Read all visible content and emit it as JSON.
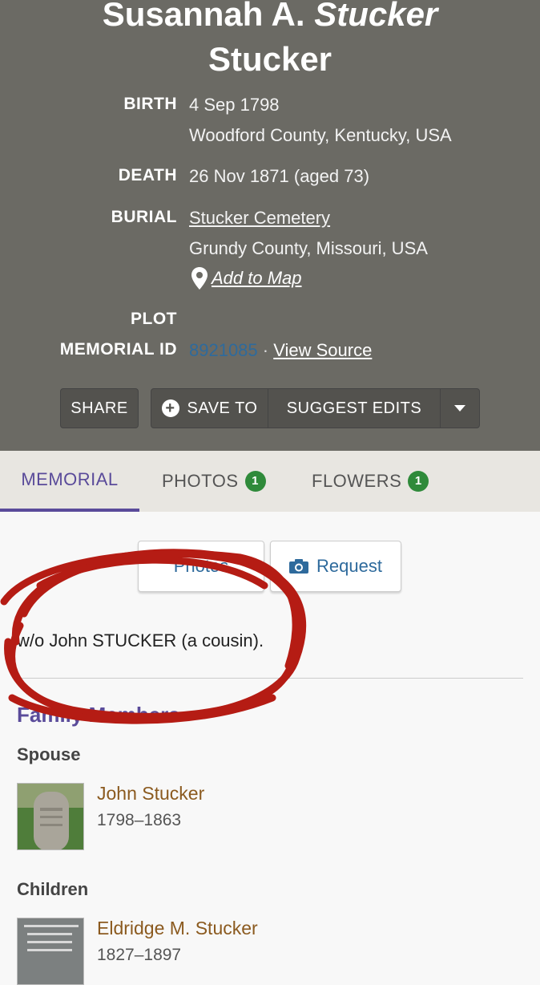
{
  "header": {
    "name_first": "Susannah A.",
    "name_maiden": "Stucker",
    "name_last": "Stucker",
    "birth_label": "BIRTH",
    "birth_date": "4 Sep 1798",
    "birth_place": "Woodford County, Kentucky, USA",
    "death_label": "DEATH",
    "death_date": "26 Nov 1871 (aged 73)",
    "burial_label": "BURIAL",
    "burial_cemetery": "Stucker Cemetery",
    "burial_place": "Grundy County, Missouri, USA",
    "add_to_map": "Add to Map",
    "plot_label": "PLOT",
    "memorial_id_label": "MEMORIAL ID",
    "memorial_id": "8921085",
    "separator": "·",
    "view_source": "View Source"
  },
  "actions": {
    "share": "SHARE",
    "save_to": "SAVE TO",
    "suggest_edits": "SUGGEST EDITS"
  },
  "tabs": [
    {
      "label": "MEMORIAL"
    },
    {
      "label": "PHOTOS",
      "count": "1"
    },
    {
      "label": "FLOWERS",
      "count": "1"
    }
  ],
  "content": {
    "photos_button": "Photos",
    "request_button": "Request",
    "bio": "w/o John STUCKER (a cousin).",
    "family_heading": "Family Members",
    "spouse_label": "Spouse",
    "children_label": "Children",
    "spouse": {
      "name": "John Stucker",
      "dates": "1798–1863"
    },
    "child": {
      "name": "Eldridge M. Stucker",
      "dates": "1827–1897"
    }
  },
  "icons": {
    "plus": "plus-circle-icon",
    "dropdown": "caret-down-icon",
    "pin": "map-pin-icon",
    "camera": "camera-icon"
  },
  "colors": {
    "header_bg": "#6b6a64",
    "accent_purple": "#5a4b9a",
    "badge_green": "#2f8a3a",
    "link_brown": "#8b5a1f",
    "link_blue": "#2e6a9c",
    "annotation_red": "#b51c14"
  }
}
